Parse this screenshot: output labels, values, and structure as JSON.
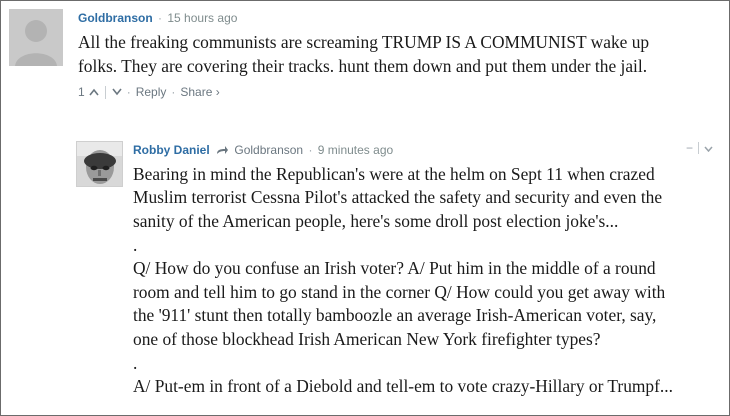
{
  "comments": [
    {
      "author": "Goldbranson",
      "time": "15 hours ago",
      "text_lines": [
        "All the freaking communists are screaming TRUMP IS A COMMUNIST wake up",
        "folks. They are covering their tracks. hunt them down and put them under the jail."
      ],
      "upvotes": "1",
      "reply_label": "Reply",
      "share_label": "Share ›"
    },
    {
      "author": "Robby Daniel",
      "reply_to": "Goldbranson",
      "time": "9 minutes ago",
      "collapse_label": "−",
      "text_lines": [
        "Bearing in mind the Republican's were at the helm on Sept 11 when crazed",
        "Muslim terrorist Cessna Pilot's attacked the safety and security and even the",
        "sanity of the American people, here's some droll post election joke's...",
        ".",
        "Q/ How do you confuse an Irish voter? A/ Put him in the middle of a round",
        "room and tell him to go stand in the corner Q/ How could you get away with",
        "the '911' stunt then totally bamboozle an average Irish-American voter, say,",
        "one of those blockhead Irish American New York firefighter types?",
        ".",
        "A/ Put-em in front of a Diebold and tell-em to vote crazy-Hillary or Trumpf..."
      ]
    }
  ],
  "separator": "·",
  "icons": {
    "upvote": "chevron-up-icon",
    "downvote": "chevron-down-icon",
    "reply_arrow": "reply-arrow-icon",
    "avatar_default": "default-avatar-icon"
  }
}
